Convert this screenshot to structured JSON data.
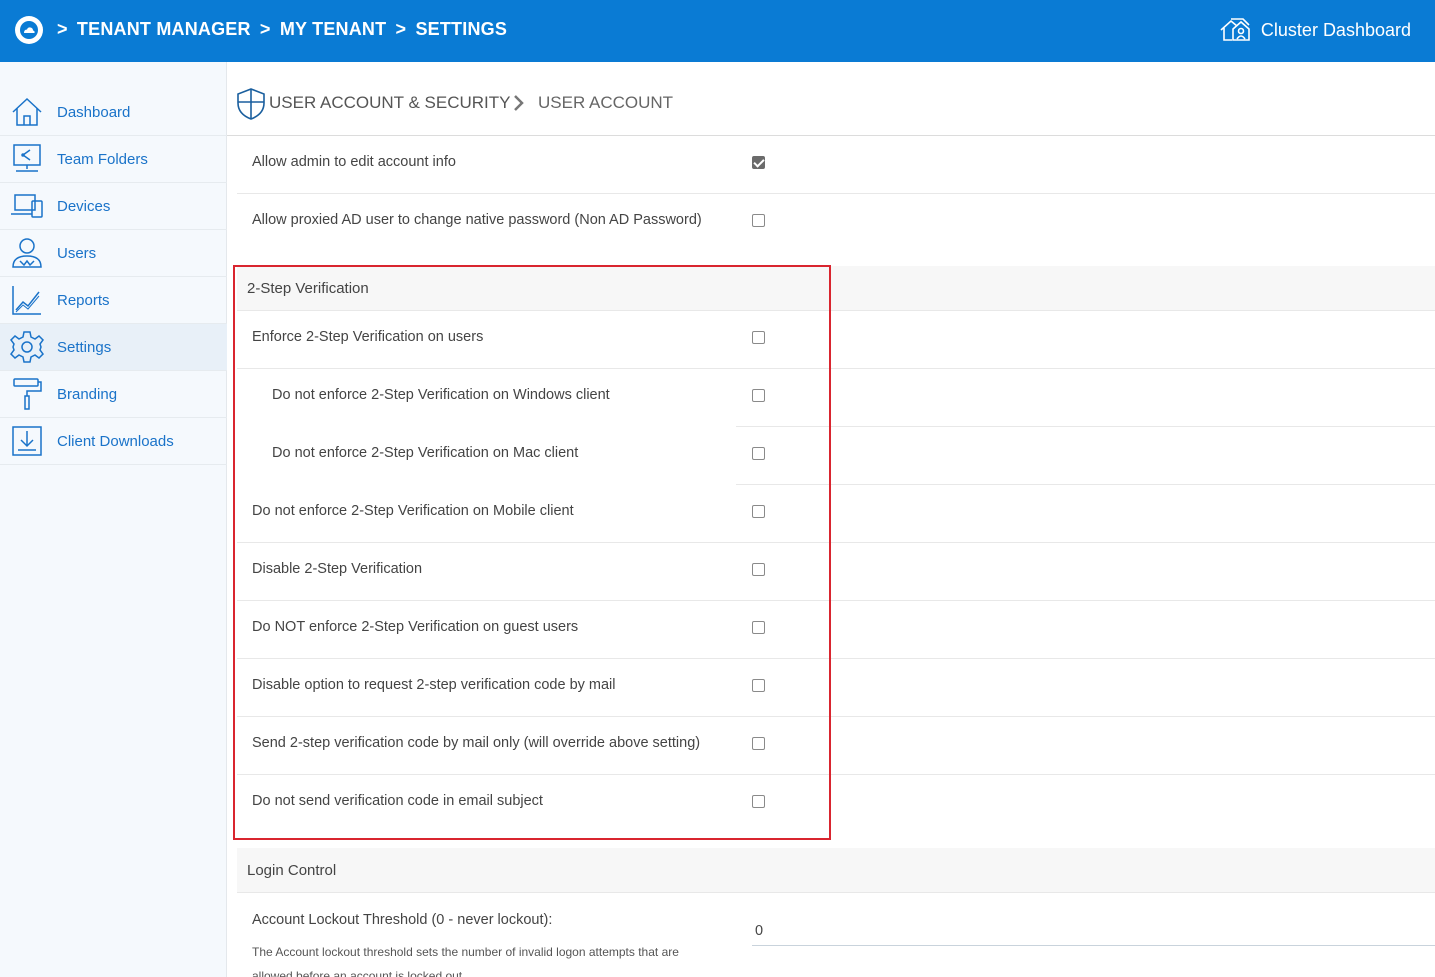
{
  "header": {
    "breadcrumb": [
      ">",
      "TENANT MANAGER",
      ">",
      "MY TENANT",
      " >",
      "SETTINGS"
    ],
    "cluster_label": "Cluster Dashboard"
  },
  "sidebar": {
    "items": [
      {
        "label": "Dashboard",
        "icon": "home-icon"
      },
      {
        "label": "Team Folders",
        "icon": "team-folder-icon"
      },
      {
        "label": "Devices",
        "icon": "devices-icon"
      },
      {
        "label": "Users",
        "icon": "users-icon"
      },
      {
        "label": "Reports",
        "icon": "reports-icon"
      },
      {
        "label": "Settings",
        "icon": "gear-icon",
        "active": true
      },
      {
        "label": "Branding",
        "icon": "paint-roller-icon"
      },
      {
        "label": "Client Downloads",
        "icon": "download-icon"
      }
    ]
  },
  "page": {
    "section": "USER ACCOUNT & SECURITY",
    "subsection": "USER ACCOUNT"
  },
  "account_rows": [
    {
      "label": "Allow admin to edit account info",
      "checked": true
    },
    {
      "label": "Allow proxied AD user to change native password (Non AD Password)",
      "checked": false
    }
  ],
  "two_step": {
    "title": "2-Step Verification",
    "rows": [
      {
        "label": "Enforce 2-Step Verification on users",
        "checked": false
      },
      {
        "label": "Do not enforce 2-Step Verification on Windows client",
        "checked": false
      },
      {
        "label": "Do not enforce 2-Step Verification on Mac client",
        "checked": false
      },
      {
        "label": "Do not enforce 2-Step Verification on Mobile client",
        "checked": false
      },
      {
        "label": "Disable 2-Step Verification",
        "checked": false
      },
      {
        "label": "Do NOT enforce 2-Step Verification on guest users",
        "checked": false
      },
      {
        "label": "Disable option to request 2-step verification code by mail",
        "checked": false
      },
      {
        "label": "Send 2-step verification code by mail only (will override above setting)",
        "checked": false
      },
      {
        "label": "Do not send verification code in email subject",
        "checked": false
      }
    ]
  },
  "login_control": {
    "title": "Login Control",
    "lockout_label": "Account Lockout Threshold (0 - never lockout):",
    "lockout_desc": "The Account lockout threshold sets the number of invalid logon attempts that are allowed before an account is locked out.",
    "lockout_value": "0"
  },
  "colors": {
    "header_bg": "#0a7bd4",
    "link_blue": "#1a73c9",
    "highlight_red": "#d9252f"
  }
}
